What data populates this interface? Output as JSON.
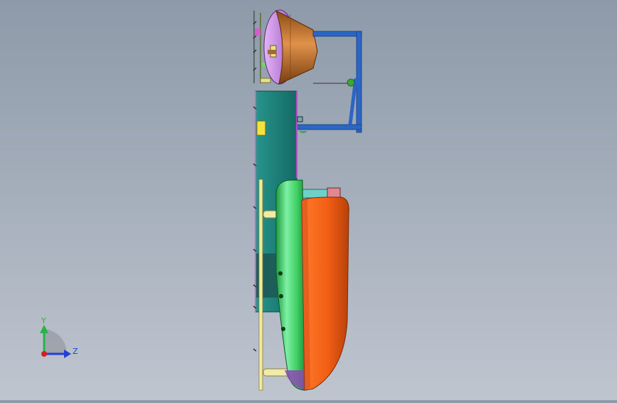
{
  "triad": {
    "y_label": "Y",
    "z_label": "Z",
    "y_color": "#2bb14a",
    "z_color": "#1e3fd8",
    "origin_color": "#d81e1e"
  },
  "colors": {
    "background_top": "#8e9aa9",
    "background_bottom": "#bfc5cf",
    "frame": "#2b66c4",
    "bowl": "#c8792e",
    "dome": "#c07be0",
    "panel": "#1a7e78",
    "hull_green": "#37c45a",
    "hull_orange": "#f25e14",
    "yellow": "#e9e08b"
  }
}
